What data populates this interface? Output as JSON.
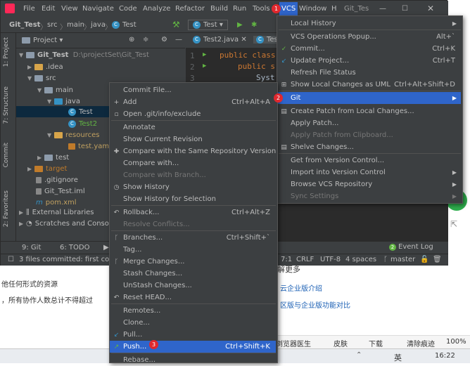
{
  "background_page": {
    "lines": [
      "解更多",
      "云企业版介绍",
      "区版与企业版功能对比",
      "他任何形式的资源",
      "，所有协作人数总计不得超过"
    ],
    "browser_bar": [
      "浏览器医生",
      "皮肤",
      "下载",
      "清除痕迹",
      "100%"
    ]
  },
  "taskbar": {
    "ime": "英",
    "time": "16:22"
  },
  "window": {
    "menu": [
      "File",
      "Edit",
      "View",
      "Navigate",
      "Code",
      "Analyze",
      "Refactor",
      "Build",
      "Run",
      "Tools",
      "VCS",
      "Window",
      "H",
      "Git_Tes"
    ],
    "nav": {
      "project": "Git_Test",
      "crumbs": [
        "src",
        "main",
        "java",
        "Test"
      ],
      "run_config": "Test"
    },
    "project_panel": {
      "title": "Project",
      "root": "Git_Test",
      "root_path": "D:\\projectSet\\Git_Test",
      "items": [
        ".idea",
        "src",
        "main",
        "java",
        "Test",
        "Test2",
        "resources",
        "test.yaml",
        "test",
        "target",
        ".gitignore",
        "Git_Test.iml",
        "pom.xml",
        "External Libraries",
        "Scratches and Consol"
      ]
    },
    "editor": {
      "tabs": [
        "Test2.java",
        "Tes"
      ],
      "line_numbers": [
        "1",
        "2",
        "3"
      ],
      "lines": [
        "public class",
        "public s",
        "Syst"
      ]
    },
    "tool_tabs": [
      "9: Git",
      "6: TODO"
    ],
    "left_tabs": [
      "1: Project",
      "7: Structure",
      "Commit",
      "2: Favorites"
    ],
    "event_log": "Event Log",
    "status": {
      "message": "3 files committed: first com",
      "position": "7:1",
      "line_sep": "CRLF",
      "encoding": "UTF-8",
      "indent": "4 spaces",
      "branch": "master"
    }
  },
  "vcs_menu": {
    "items": [
      {
        "label": "Local History",
        "shortcut": "",
        "sub": true,
        "icon": ""
      },
      {
        "label": "VCS Operations Popup...",
        "shortcut": "Alt+`",
        "icon": ""
      },
      {
        "label": "Commit...",
        "shortcut": "Ctrl+K",
        "icon": "✓"
      },
      {
        "label": "Update Project...",
        "shortcut": "Ctrl+T",
        "icon": "↙"
      },
      {
        "label": "Refresh File Status",
        "shortcut": "",
        "icon": ""
      },
      {
        "label": "Show Local Changes as UML",
        "shortcut": "Ctrl+Alt+Shift+D",
        "icon": "⊞"
      },
      {
        "label": "Git",
        "shortcut": "",
        "sub": true,
        "icon": "",
        "selected": true
      },
      {
        "label": "Create Patch from Local Changes...",
        "shortcut": "",
        "icon": "▤"
      },
      {
        "label": "Apply Patch...",
        "shortcut": "",
        "icon": ""
      },
      {
        "label": "Apply Patch from Clipboard...",
        "shortcut": "",
        "icon": "",
        "disabled": true
      },
      {
        "label": "Shelve Changes...",
        "shortcut": "",
        "icon": "▤"
      },
      {
        "label": "Get from Version Control...",
        "shortcut": "",
        "icon": ""
      },
      {
        "label": "Import into Version Control",
        "shortcut": "",
        "sub": true,
        "icon": ""
      },
      {
        "label": "Browse VCS Repository",
        "shortcut": "",
        "sub": true,
        "icon": ""
      },
      {
        "label": "Sync Settings",
        "shortcut": "",
        "sub": true,
        "icon": "",
        "disabled": true
      }
    ]
  },
  "git_menu": {
    "items": [
      {
        "label": "Commit File...",
        "shortcut": "",
        "icon": ""
      },
      {
        "label": "Add",
        "shortcut": "Ctrl+Alt+A",
        "icon": "+"
      },
      {
        "label": "Open .git/info/exclude",
        "shortcut": "",
        "icon": "▫"
      },
      {
        "label": "Annotate",
        "shortcut": "",
        "icon": ""
      },
      {
        "label": "Show Current Revision",
        "shortcut": "",
        "icon": ""
      },
      {
        "label": "Compare with the Same Repository Version",
        "shortcut": "",
        "icon": "✚"
      },
      {
        "label": "Compare with...",
        "shortcut": "",
        "icon": ""
      },
      {
        "label": "Compare with Branch...",
        "shortcut": "",
        "icon": "",
        "disabled": true
      },
      {
        "label": "Show History",
        "shortcut": "",
        "icon": "◷"
      },
      {
        "label": "Show History for Selection",
        "shortcut": "",
        "icon": ""
      },
      {
        "label": "Rollback...",
        "shortcut": "Ctrl+Alt+Z",
        "icon": "↶"
      },
      {
        "label": "Resolve Conflicts...",
        "shortcut": "",
        "icon": "",
        "disabled": true
      },
      {
        "label": "Branches...",
        "shortcut": "Ctrl+Shift+`",
        "icon": "ᚴ"
      },
      {
        "label": "Tag...",
        "shortcut": "",
        "icon": ""
      },
      {
        "label": "Merge Changes...",
        "shortcut": "",
        "icon": "ᚴ"
      },
      {
        "label": "Stash Changes...",
        "shortcut": "",
        "icon": ""
      },
      {
        "label": "UnStash Changes...",
        "shortcut": "",
        "icon": ""
      },
      {
        "label": "Reset HEAD...",
        "shortcut": "",
        "icon": "↶"
      },
      {
        "label": "Remotes...",
        "shortcut": "",
        "icon": ""
      },
      {
        "label": "Clone...",
        "shortcut": "",
        "icon": ""
      },
      {
        "label": "Pull...",
        "shortcut": "",
        "icon": "↙"
      },
      {
        "label": "Push...",
        "shortcut": "Ctrl+Shift+K",
        "icon": "↗",
        "selected": true
      },
      {
        "label": "Rebase...",
        "shortcut": "",
        "icon": ""
      }
    ]
  },
  "markers": [
    "1",
    "2",
    "3"
  ],
  "colors": {
    "bg": "#3c3f41",
    "editor": "#2b2b2b",
    "selection": "#2f65ca",
    "badge": "#e0282e",
    "keyword": "#cc7832"
  }
}
